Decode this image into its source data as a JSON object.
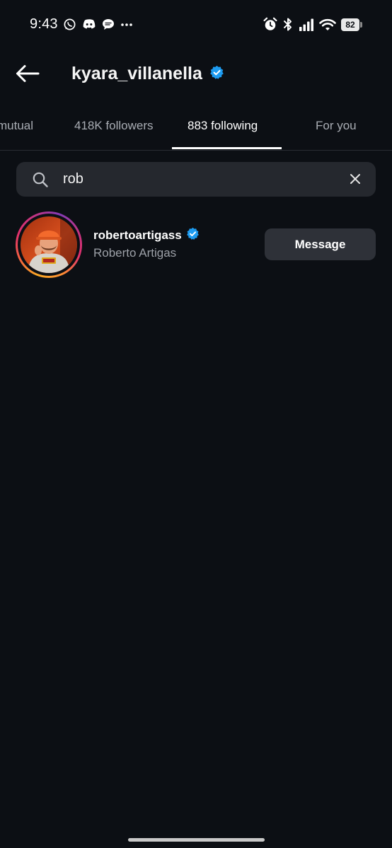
{
  "status_bar": {
    "time": "9:43",
    "left_icons": [
      "whatsapp-icon",
      "discord-icon",
      "chat-bubble-icon",
      "more-dots-icon"
    ],
    "right_icons": [
      "alarm-icon",
      "bluetooth-icon",
      "signal-icon",
      "wifi-icon"
    ],
    "battery_level": "82"
  },
  "header": {
    "title": "kyara_villanella",
    "verified": true
  },
  "tabs": [
    {
      "label": "mutual",
      "active": false
    },
    {
      "label": "418K followers",
      "active": false
    },
    {
      "label": "883 following",
      "active": true
    },
    {
      "label": "For you",
      "active": false
    }
  ],
  "search": {
    "value": "rob",
    "placeholder": "Search"
  },
  "results": [
    {
      "username": "robertoartigass",
      "full_name": "Roberto Artigas",
      "verified": true,
      "has_story_ring": true,
      "action_label": "Message"
    }
  ],
  "colors": {
    "background": "#0c0f14",
    "search_bg": "#25282e",
    "button_bg": "#2e3138",
    "verified_blue": "#1d9bf0",
    "secondary_text": "#9da1a8"
  }
}
